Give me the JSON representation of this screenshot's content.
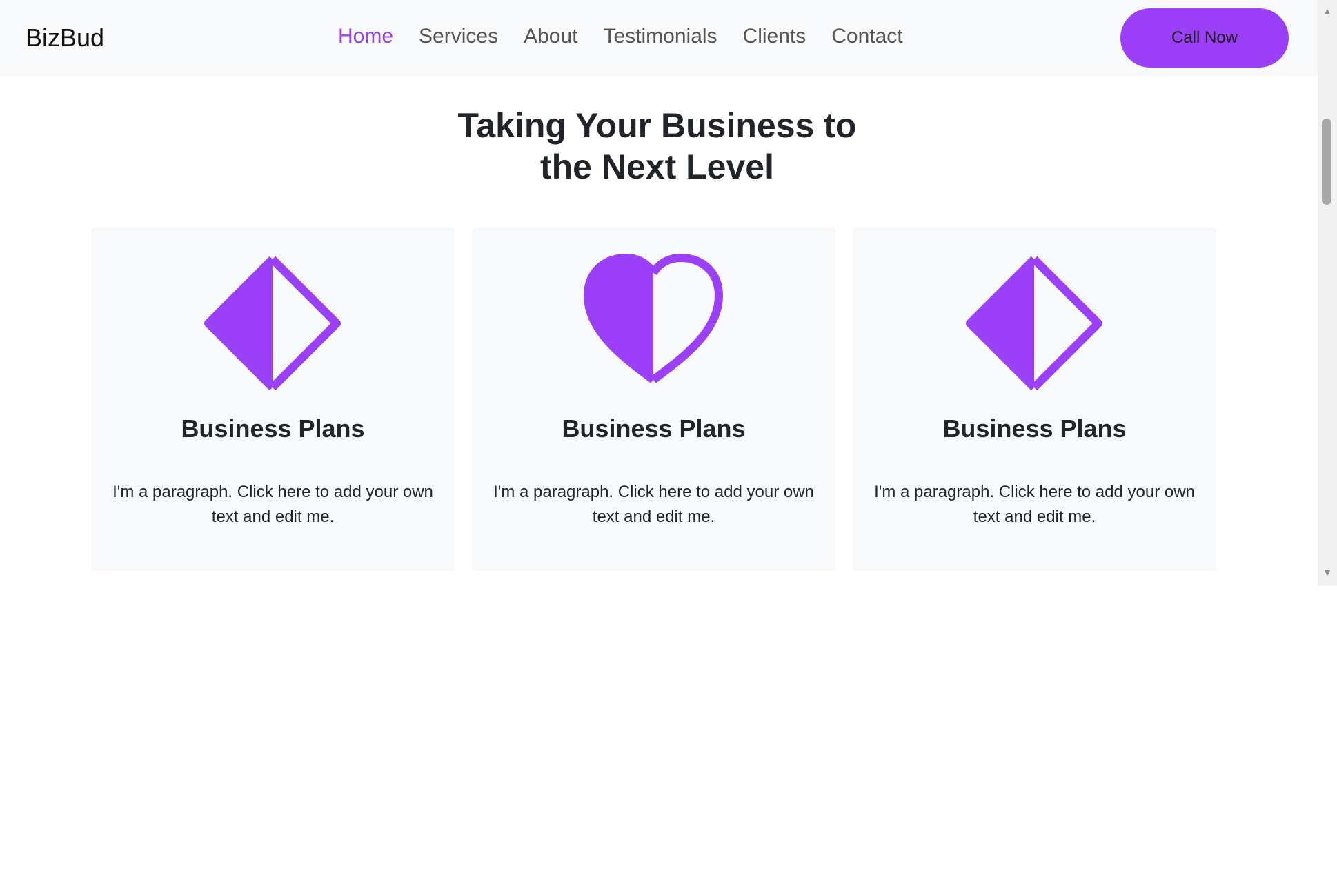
{
  "navbar": {
    "brand": "BizBud",
    "links": [
      {
        "label": "Home",
        "active": true
      },
      {
        "label": "Services",
        "active": false
      },
      {
        "label": "About",
        "active": false
      },
      {
        "label": "Testimonials",
        "active": false
      },
      {
        "label": "Clients",
        "active": false
      },
      {
        "label": "Contact",
        "active": false
      }
    ],
    "cta_label": "Call Now"
  },
  "hero": {
    "title_line1": "Taking Your Business to",
    "title_line2": "the Next Level"
  },
  "cards": [
    {
      "icon": "half-diamond-icon",
      "title": "Business Plans",
      "text": "I'm a paragraph. Click here to add your own text and edit me."
    },
    {
      "icon": "half-heart-icon",
      "title": "Business Plans",
      "text": "I'm a paragraph. Click here to add your own text and edit me."
    },
    {
      "icon": "half-diamond-icon",
      "title": "Business Plans",
      "text": "I'm a paragraph. Click here to add your own text and edit me."
    }
  ],
  "scrollbar": {
    "up_arrow": "▲",
    "down_arrow": "▼"
  },
  "colors": {
    "accent": "#9b3ff8",
    "active_link": "#9b42e6",
    "navbar_bg": "#f8f9fa",
    "card_bg": "#f8f9fa"
  }
}
